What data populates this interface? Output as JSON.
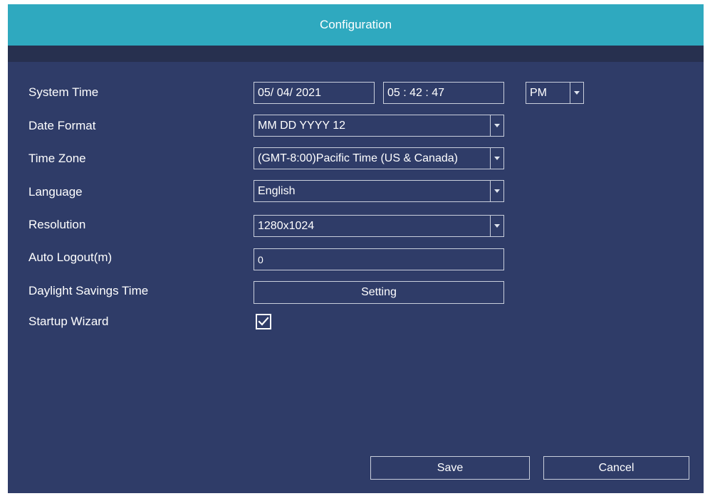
{
  "window": {
    "title": "Configuration"
  },
  "form": {
    "system_time": {
      "label": "System Time",
      "date": "05/ 04/ 2021",
      "time": "05 : 42 : 47",
      "ampm": "PM"
    },
    "date_format": {
      "label": "Date Format",
      "value": "MM DD YYYY 12"
    },
    "time_zone": {
      "label": "Time Zone",
      "value": "(GMT-8:00)Pacific Time (US & Canada)"
    },
    "language": {
      "label": "Language",
      "value": "English"
    },
    "resolution": {
      "label": "Resolution",
      "value": "1280x1024"
    },
    "auto_logout": {
      "label": "Auto Logout(m)",
      "value": "0"
    },
    "daylight_savings": {
      "label": "Daylight Savings Time",
      "button_label": "Setting"
    },
    "startup_wizard": {
      "label": "Startup Wizard",
      "checked": true
    }
  },
  "footer": {
    "save_label": "Save",
    "cancel_label": "Cancel"
  },
  "colors": {
    "titlebar": "#2fa9bf",
    "panel": "#2f3c68",
    "subbar": "#27304f",
    "border": "#c9cfdc",
    "text": "#ffffff"
  },
  "icons": {
    "dropdown": "chevron-down-icon",
    "check": "checkmark-icon"
  }
}
